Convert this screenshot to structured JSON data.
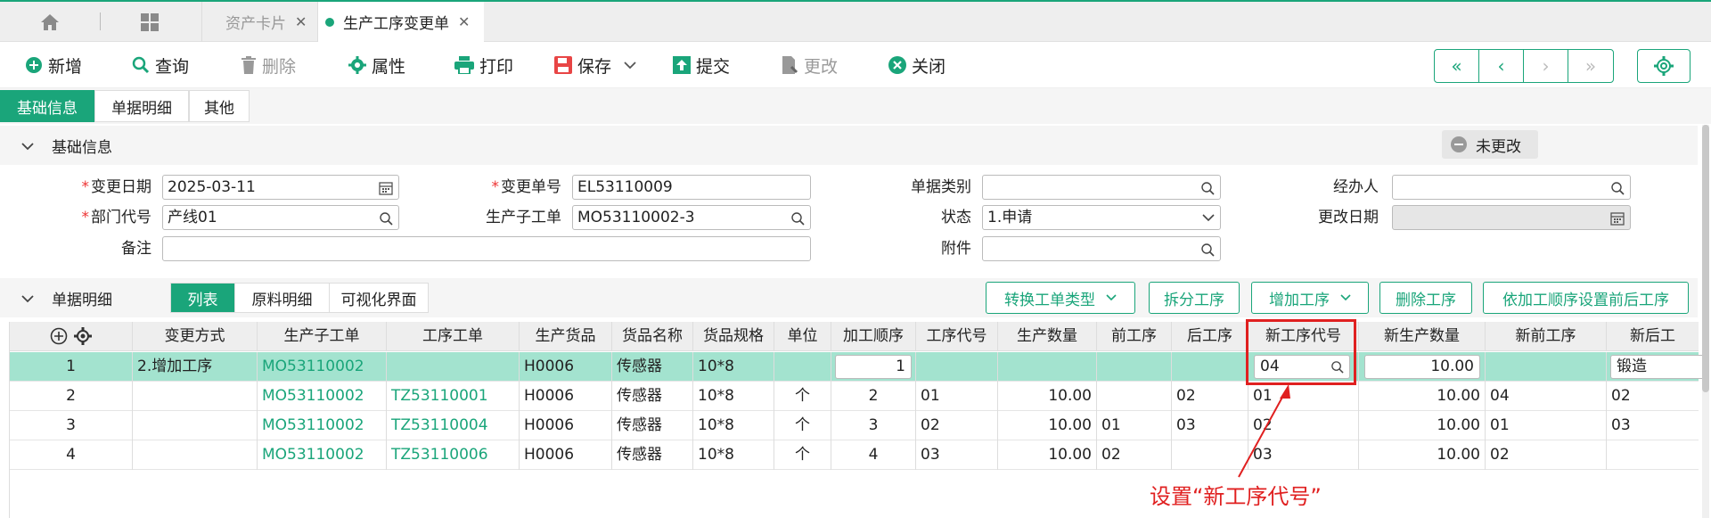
{
  "tabs": {
    "items": [
      {
        "label": "资产卡片",
        "active": false
      },
      {
        "label": "生产工序变更单",
        "active": true
      }
    ],
    "close_glyph": "✕"
  },
  "toolbar": {
    "add": "新增",
    "query": "查询",
    "delete": "删除",
    "properties": "属性",
    "print": "打印",
    "save": "保存",
    "submit": "提交",
    "modify": "更改",
    "close": "关闭"
  },
  "nav": {
    "first": "«",
    "prev": "‹",
    "next": "›",
    "last": "»"
  },
  "subtabs": [
    "基础信息",
    "单据明细",
    "其他"
  ],
  "basic": {
    "section_title": "基础信息",
    "status_badge": "未更改",
    "labels": {
      "change_date": "变更日期",
      "change_no": "变更单号",
      "doc_type": "单据类别",
      "handler": "经办人",
      "dept_code": "部门代号",
      "sub_order": "生产子工单",
      "status": "状态",
      "modify_date": "更改日期",
      "remark": "备注",
      "attachment": "附件"
    },
    "values": {
      "change_date": "2025-03-11",
      "change_no": "EL53110009",
      "doc_type": "",
      "handler": "",
      "dept_code": "产线01",
      "sub_order": "MO53110002-3",
      "status": "1.申请",
      "modify_date": "",
      "remark": "",
      "attachment": ""
    },
    "required_mark": "*"
  },
  "detail": {
    "section_title": "单据明细",
    "view_tabs": [
      "列表",
      "原料明细",
      "可视化界面"
    ],
    "actions": {
      "convert": "转换工单类型",
      "split": "拆分工序",
      "add_process": "增加工序",
      "delete_process": "删除工序",
      "set_order": "依加工顺序设置前后工序"
    },
    "columns": [
      "变更方式",
      "生产子工单",
      "工序工单",
      "生产货品",
      "货品名称",
      "货品规格",
      "单位",
      "加工顺序",
      "工序代号",
      "生产数量",
      "前工序",
      "后工序",
      "新工序代号",
      "新生产数量",
      "新前工序",
      "新后工"
    ],
    "rows": [
      {
        "no": "1",
        "mode": "2.增加工序",
        "sub_order": "MO53110002",
        "proc_order": "",
        "product": "H0006",
        "name": "传感器",
        "spec": "10*8",
        "unit": "",
        "seq": "1",
        "proc_code": "",
        "qty": "",
        "prev": "",
        "next": "",
        "new_code": "04",
        "new_qty": "10.00",
        "new_prev": "",
        "new_next": "锻造"
      },
      {
        "no": "2",
        "mode": "",
        "sub_order": "MO53110002",
        "proc_order": "TZ53110001",
        "product": "H0006",
        "name": "传感器",
        "spec": "10*8",
        "unit": "个",
        "seq": "2",
        "proc_code": "01",
        "qty": "10.00",
        "prev": "",
        "next": "02",
        "new_code": "01",
        "new_qty": "10.00",
        "new_prev": "04",
        "new_next": "02"
      },
      {
        "no": "3",
        "mode": "",
        "sub_order": "MO53110002",
        "proc_order": "TZ53110004",
        "product": "H0006",
        "name": "传感器",
        "spec": "10*8",
        "unit": "个",
        "seq": "3",
        "proc_code": "02",
        "qty": "10.00",
        "prev": "01",
        "next": "03",
        "new_code": "02",
        "new_qty": "10.00",
        "new_prev": "01",
        "new_next": "03"
      },
      {
        "no": "4",
        "mode": "",
        "sub_order": "MO53110002",
        "proc_order": "TZ53110006",
        "product": "H0006",
        "name": "传感器",
        "spec": "10*8",
        "unit": "个",
        "seq": "4",
        "proc_code": "03",
        "qty": "10.00",
        "prev": "02",
        "next": "",
        "new_code": "03",
        "new_qty": "10.00",
        "new_prev": "02",
        "new_next": ""
      }
    ]
  },
  "annotation": "设置“新工序代号”",
  "colors": {
    "accent": "#1aa57a",
    "selected_row": "#a3e3cf",
    "annotation": "#e02020"
  }
}
